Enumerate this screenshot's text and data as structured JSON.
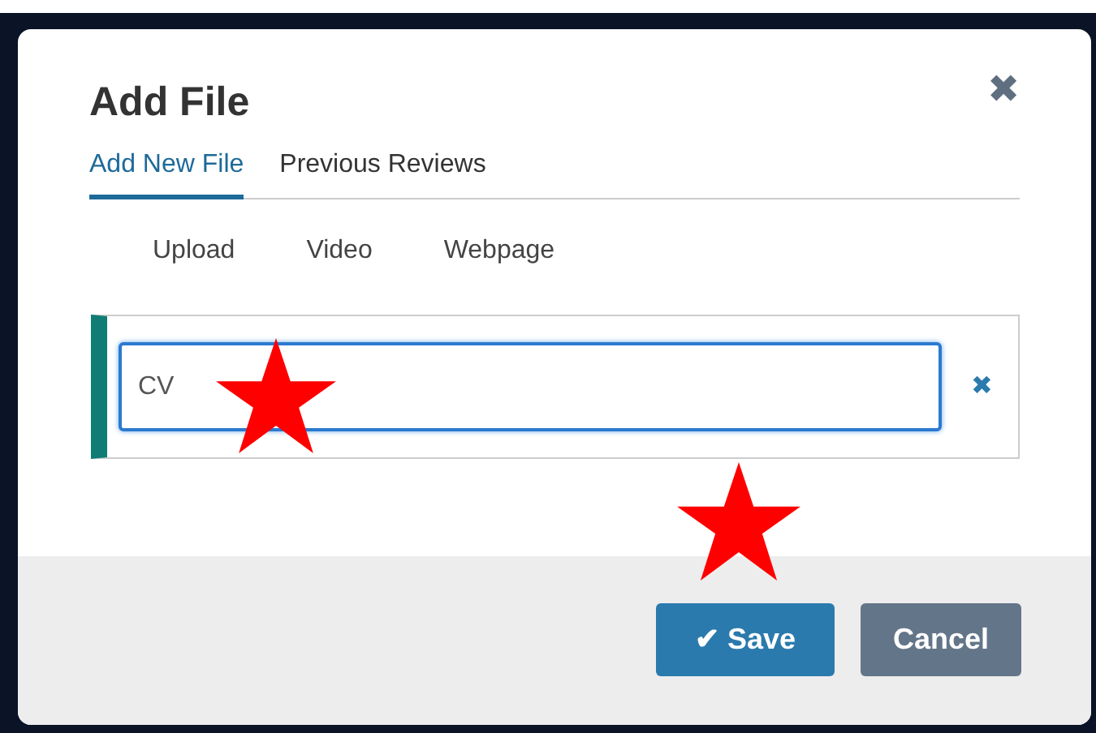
{
  "dialog": {
    "title": "Add File",
    "close": "✖"
  },
  "tabs": [
    {
      "label": "Add New File",
      "selected": true
    },
    {
      "label": "Previous Reviews",
      "selected": false
    }
  ],
  "sources": [
    "Upload",
    "Video",
    "Webpage"
  ],
  "file_entry": {
    "value": "CV",
    "focused": true,
    "remove": "✖"
  },
  "buttons": [
    {
      "kind": "primary",
      "label": "Save",
      "icon": "✔"
    },
    {
      "kind": "secondary",
      "label": "Cancel"
    }
  ]
}
